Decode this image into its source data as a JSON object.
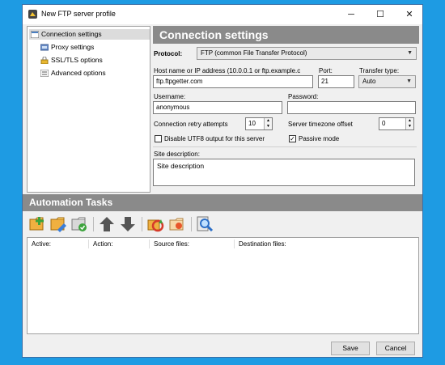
{
  "window": {
    "title": "New FTP server profile",
    "minimize": "─",
    "maximize": "☐",
    "close": "✕"
  },
  "sidebar": {
    "items": [
      {
        "label": "Connection settings",
        "icon": "connection-icon"
      },
      {
        "label": "Proxy settings",
        "icon": "proxy-icon"
      },
      {
        "label": "SSL/TLS options",
        "icon": "lock-icon"
      },
      {
        "label": "Advanced options",
        "icon": "advanced-icon"
      }
    ]
  },
  "panel": {
    "title": "Connection settings",
    "protocol_label": "Protocol:",
    "protocol_value": "FTP (common File Transfer Protocol)",
    "host_label": "Host name or IP address (10.0.0.1 or ftp.example.c",
    "host_value": "ftp.ftpgetter.com",
    "port_label": "Port:",
    "port_value": "21",
    "transfer_label": "Transfer type:",
    "transfer_value": "Auto",
    "username_label": "Username:",
    "username_value": "anonymous",
    "password_label": "Password:",
    "password_value": "",
    "retry_label": "Connection retry attempts",
    "retry_value": "10",
    "timezone_label": "Server timezone offset",
    "timezone_value": "0",
    "utf8_label": "Disable UTF8 output for this server",
    "utf8_checked": false,
    "passive_label": "Passive mode",
    "passive_checked": true,
    "site_desc_label": "Site description:",
    "site_desc_value": "Site description"
  },
  "automation": {
    "title": "Automation Tasks",
    "columns": [
      "Active:",
      "Action:",
      "Source files:",
      "Destination files:"
    ]
  },
  "footer": {
    "save": "Save",
    "cancel": "Cancel"
  },
  "colors": {
    "background": "#1e9be3",
    "header": "#8a8a8a",
    "window": "#f0f0f0"
  }
}
